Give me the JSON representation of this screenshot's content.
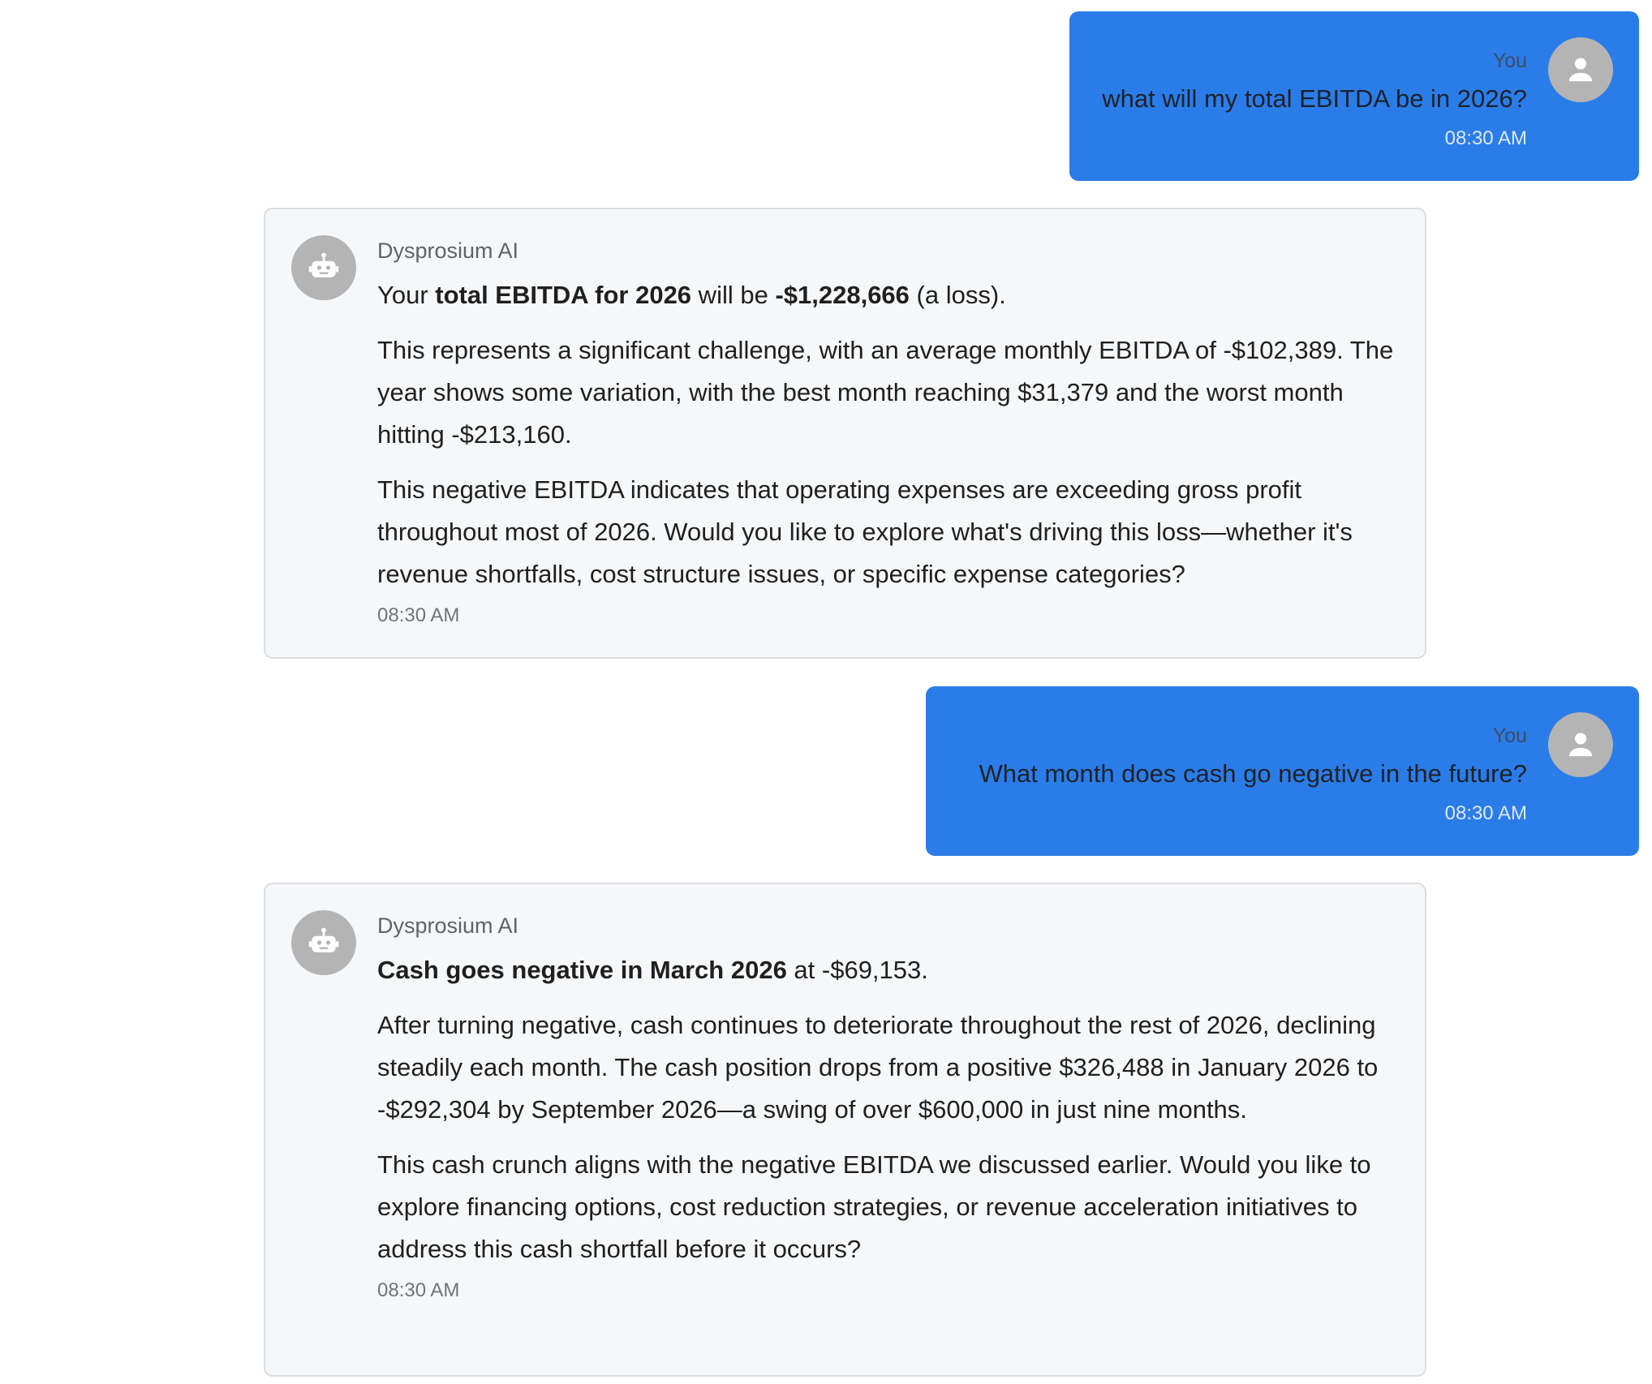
{
  "colors": {
    "user_bubble": "#2a7de9",
    "ai_bubble": "#f6f7f9",
    "avatar": "#b4b4b4"
  },
  "messages": [
    {
      "role": "user",
      "icon": "person-icon",
      "sender": "You",
      "text": "what will my total EBITDA be in 2026?",
      "time": "08:30 AM"
    },
    {
      "role": "assistant",
      "icon": "robot-icon",
      "sender": "Dysprosium AI",
      "lead": {
        "pre": "Your ",
        "bold1": "total EBITDA for 2026",
        "mid": " will be ",
        "bold2": "-$1,228,666",
        "post": " (a loss)."
      },
      "paragraphs": [
        "This represents a significant challenge, with an average monthly EBITDA of -$102,389. The year shows some variation, with the best month reaching $31,379 and the worst month hitting -$213,160.",
        "This negative EBITDA indicates that operating expenses are exceeding gross profit throughout most of 2026. Would you like to explore what's driving this loss—whether it's revenue shortfalls, cost structure issues, or specific expense categories?"
      ],
      "time": "08:30 AM"
    },
    {
      "role": "user",
      "icon": "person-icon",
      "sender": "You",
      "text": "What month does cash go negative in the future?",
      "time": "08:30 AM"
    },
    {
      "role": "assistant",
      "icon": "robot-icon",
      "sender": "Dysprosium AI",
      "lead": {
        "bold1": "Cash goes negative in March 2026",
        "post": " at -$69,153."
      },
      "paragraphs": [
        "After turning negative, cash continues to deteriorate throughout the rest of 2026, declining steadily each month. The cash position drops from a positive $326,488 in January 2026 to -$292,304 by September 2026—a swing of over $600,000 in just nine months.",
        "This cash crunch aligns with the negative EBITDA we discussed earlier. Would you like to explore financing options, cost reduction strategies, or revenue acceleration initiatives to address this cash shortfall before it occurs?"
      ],
      "time": "08:30 AM"
    }
  ]
}
